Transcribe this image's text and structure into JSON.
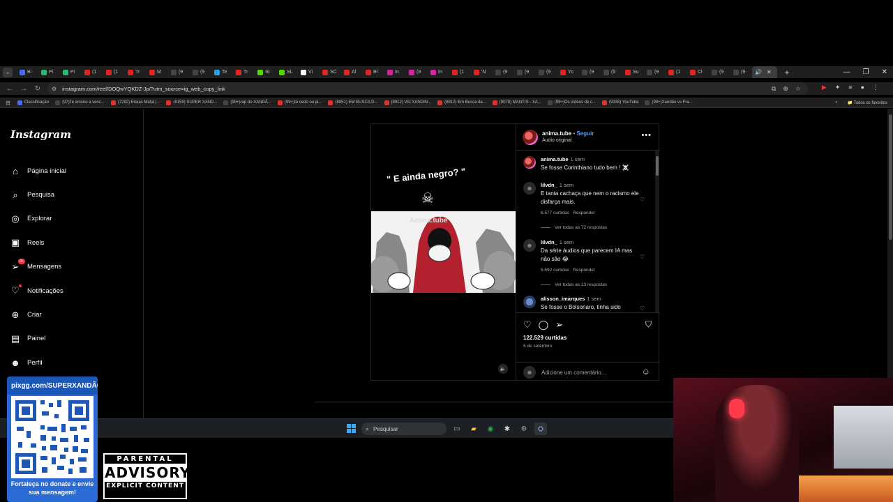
{
  "browser": {
    "tabs": [
      "Bi",
      "Pi",
      "Pi",
      "(1",
      "(1",
      "Tr",
      "M",
      "(9",
      "(9",
      "Te",
      "Tr",
      "St",
      "SL",
      "Vi",
      "SC",
      "Al",
      "Bl",
      "In",
      "(8",
      "In",
      "(1",
      "'N",
      "(9",
      "(9",
      "(9",
      "Yc",
      "(9",
      "(9",
      "Su",
      "(9",
      "(1",
      "Cl",
      "(9",
      "(9"
    ],
    "tab_colors": [
      "#4a6cf7",
      "#2bb673",
      "#2bb673",
      "#e02424",
      "#e02424",
      "#e02424",
      "#e02424",
      "#444444",
      "#444444",
      "#2aa1e0",
      "#e02424",
      "#53d600",
      "#53d600",
      "#ffffff",
      "#e02424",
      "#e02424",
      "#e02424",
      "#d6249f",
      "#d6249f",
      "#d6249f",
      "#e02424",
      "#e02424",
      "#444444",
      "#444444",
      "#444444",
      "#e02424",
      "#444444",
      "#444444",
      "#e02424",
      "#444444",
      "#e02424",
      "#e02424",
      "#444444",
      "#444444"
    ],
    "url": "instagram.com/reel/DOQwYQKDZ-Jp/?utm_source=ig_web_copy_link",
    "bookmarks": [
      "Classificação",
      "(97)Te ensino a venc...",
      "(7292) Enéas Metal |...",
      "(8159) SUPER XAND...",
      "(99+)rap do XANDÃ...",
      "(99+)tá cedo ou já...",
      "(8851) EM BUSCA D...",
      "(8912) VAI XANDIN...",
      "(8912) Em Busca da...",
      "(9078) MANTIS - XA...",
      "(99+)Os vídeos de c...",
      "(9338) YouTube",
      "(99+)Xandão vs Fra..."
    ],
    "all_bookmarks": "Todos os favoritos"
  },
  "sidebar": {
    "logo": "Instagram",
    "items": [
      {
        "label": "Página inicial",
        "icon": "home-icon"
      },
      {
        "label": "Pesquisa",
        "icon": "search-icon"
      },
      {
        "label": "Explorar",
        "icon": "compass-icon"
      },
      {
        "label": "Reels",
        "icon": "reels-icon"
      },
      {
        "label": "Mensagens",
        "icon": "messages-icon",
        "badge": "9+"
      },
      {
        "label": "Notificações",
        "icon": "heart-icon"
      },
      {
        "label": "Criar",
        "icon": "plus-icon"
      },
      {
        "label": "Painel",
        "icon": "dashboard-icon"
      },
      {
        "label": "Perfil",
        "icon": "profile-icon"
      }
    ]
  },
  "post": {
    "overlay_text": "\" E ainda negro? \"",
    "watermark": "Anima.tube",
    "author": "anima.tube",
    "follow": "Seguir",
    "audio": "Áudio original",
    "likes": "122.529 curtidas",
    "date": "6 de setembro",
    "comment_placeholder": "Adicione um comentário..."
  },
  "comments": [
    {
      "user": "anima.tube",
      "time": "1 sem",
      "text": "Se fosse Corinthiano tudo bem ! ☠️"
    },
    {
      "user": "lilvdn_",
      "time": "1 sem",
      "text": "E tanta cachaça que nem o racismo ele disfarça mais.",
      "likes": "8.577 curtidas",
      "reply": "Responder",
      "replies": "Ver todas as 72 respostas"
    },
    {
      "user": "lilvdn_",
      "time": "1 sem",
      "text": "Da série áudios que parecem IA mas não são 😂",
      "likes": "5.592 curtidas",
      "reply": "Responder",
      "replies": "Ver todas as 23 respostas"
    },
    {
      "user": "alisson_imarques",
      "time": "1 sem",
      "text": "Se fosse o Bolsonaro, tinha sido"
    }
  ],
  "taskbar": {
    "search": "Pesquisar"
  },
  "overlay": {
    "donate_title": "pixgg.com/SUPERXANDÃO",
    "donate_msg": "Fortaleça no donate e envie sua mensagem!",
    "advisory_top": "PARENTAL",
    "advisory_mid": "ADVISORY",
    "advisory_bot": "EXPLICIT CONTENT"
  }
}
